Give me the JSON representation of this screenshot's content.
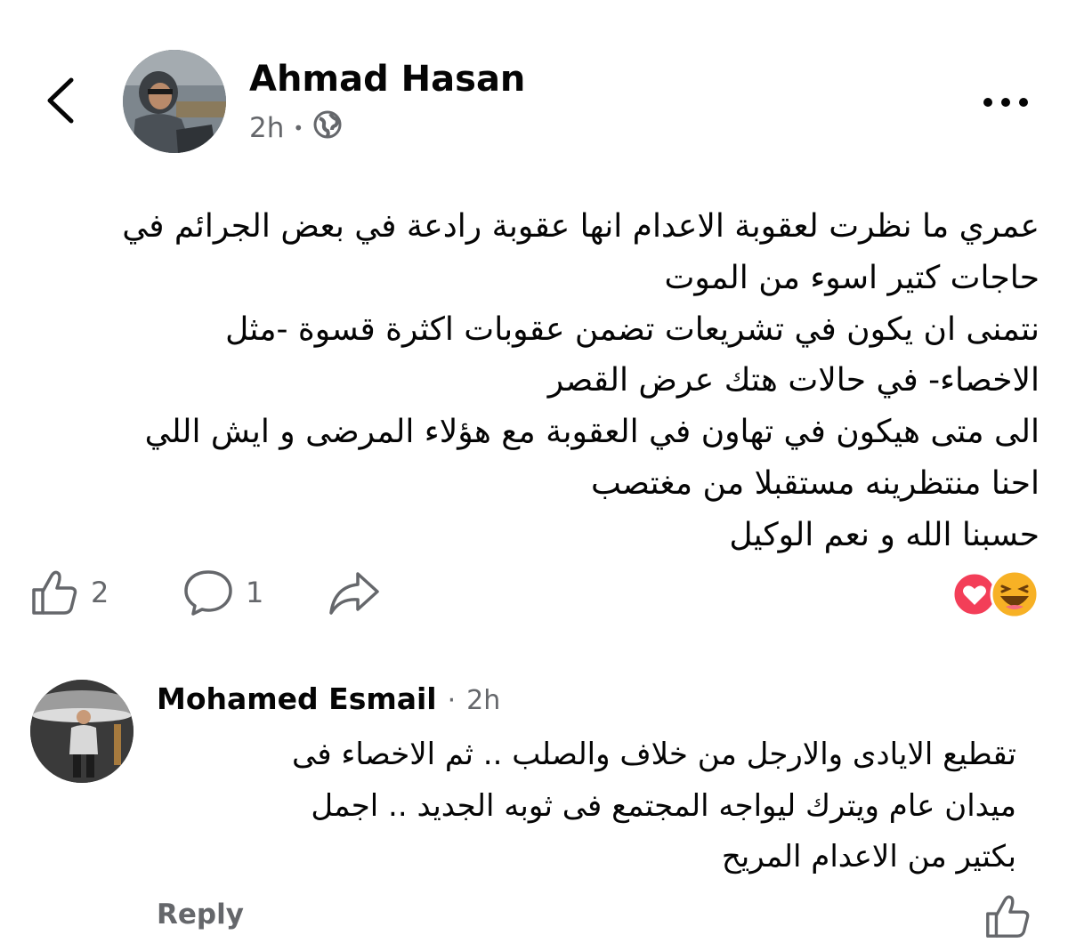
{
  "post": {
    "author_name": "Ahmad Hasan",
    "time": "2h",
    "privacy_icon": "globe-icon",
    "body": "عمري ما نظرت لعقوبة الاعدام انها عقوبة رادعة في بعض الجرائم في\nحاجات كتير اسوء من الموت\nنتمنى ان يكون في تشريعات تضمن عقوبات اكثرة قسوة -مثل\nالاخصاء- في حالات هتك عرض القصر\nالى متى هيكون في تهاون في العقوبة مع هؤلاء المرضى و ايش اللي\nاحنا منتظرينه مستقبلا من مغتصب\nحسبنا الله و نعم الوكيل"
  },
  "actions": {
    "like_count": "2",
    "comment_count": "1",
    "reactions": [
      "love-icon",
      "haha-icon"
    ]
  },
  "comment": {
    "author_name": "Mohamed Esmail",
    "separator": "·",
    "time": "2h",
    "text": "تقطيع الايادى والارجل من خلاف والصلب .. ثم الاخصاء فى\nميدان عام ويترك ليواجه المجتمع فى ثوبه الجديد .. اجمل\nبكتير من الاعدام المريح",
    "reply_label": "Reply"
  },
  "colors": {
    "text": "#050505",
    "secondary": "#65676b",
    "love": "#f33e58",
    "haha": "#f7b125"
  }
}
